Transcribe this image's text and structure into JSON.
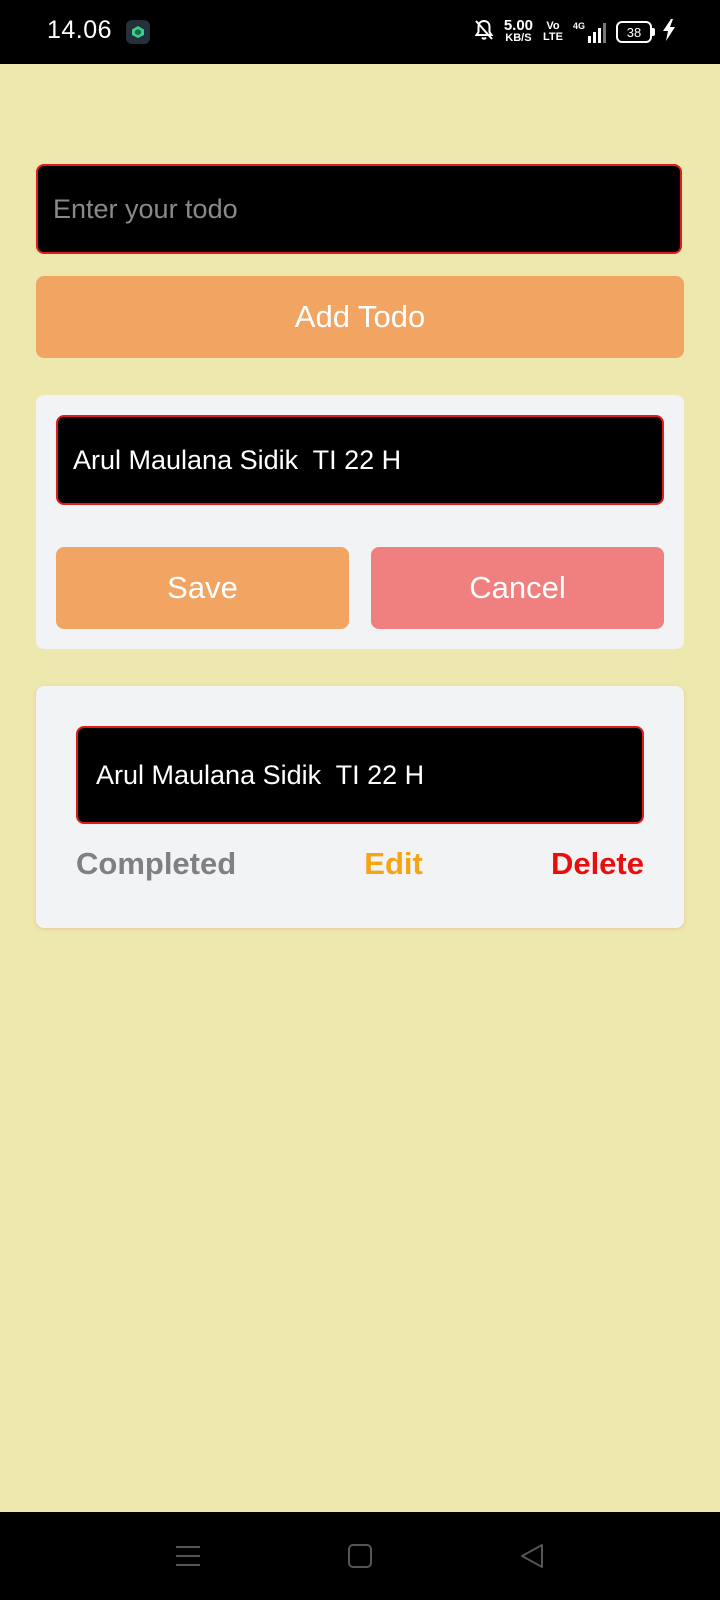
{
  "status_bar": {
    "time": "14.06",
    "net_speed_value": "5.00",
    "net_speed_unit": "KB/S",
    "volte_top": "Vo",
    "volte_bottom": "LTE",
    "network_type": "4G",
    "battery_level": "38",
    "icons": [
      "app-notification-icon",
      "mute-bell-icon",
      "signal-icon",
      "battery-icon",
      "charging-icon"
    ]
  },
  "add_form": {
    "placeholder": "Enter your todo",
    "value": "",
    "add_label": "Add Todo"
  },
  "edit_card": {
    "value": "Arul Maulana Sidik  TI 22 H",
    "save_label": "Save",
    "cancel_label": "Cancel"
  },
  "todos": [
    {
      "text": "Arul Maulana Sidik  TI 22 H",
      "completed_label": "Completed",
      "edit_label": "Edit",
      "delete_label": "Delete"
    }
  ],
  "nav_bar": {
    "icons": [
      "menu-icon",
      "home-icon",
      "back-icon"
    ]
  },
  "colors": {
    "background": "#ede8ad",
    "primary_button": "#f2a563",
    "cancel_button": "#f08080",
    "input_border": "#e01b1b",
    "completed_text": "#808080",
    "edit_text": "#f5a414",
    "delete_text": "#e80e0e"
  }
}
